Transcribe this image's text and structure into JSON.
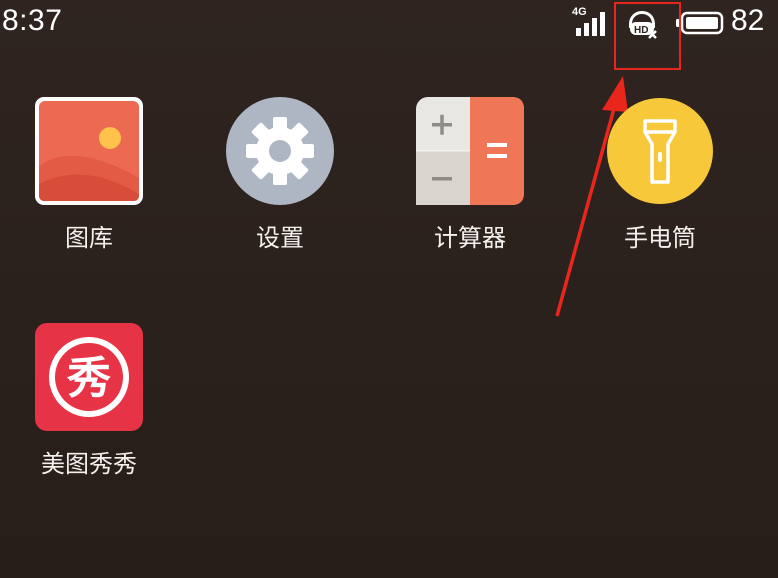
{
  "status_bar": {
    "time": "8:37",
    "network_label": "4G",
    "battery_level": "82",
    "hd_icon": "hd-voice-off-icon"
  },
  "apps": [
    {
      "label": "图库",
      "icon": "gallery-icon"
    },
    {
      "label": "设置",
      "icon": "gear-icon"
    },
    {
      "label": "计算器",
      "icon": "calculator-icon"
    },
    {
      "label": "手电筒",
      "icon": "flashlight-icon"
    },
    {
      "label": "美图秀秀",
      "icon": "meitu-icon",
      "icon_text": "秀"
    }
  ],
  "colors": {
    "annotation": "#e8261b",
    "gallery": "#ec6a52",
    "settings": "#aeb6c4",
    "calculator_accent": "#ef7656",
    "flashlight": "#f7c93a",
    "meitu": "#e63446"
  }
}
